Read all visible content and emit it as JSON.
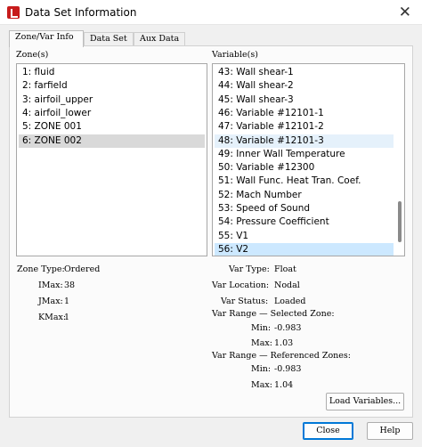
{
  "window": {
    "title": "Data Set Information",
    "close_glyph": "✕"
  },
  "tabs": [
    {
      "label": "Zone/Var Info"
    },
    {
      "label": "Data Set"
    },
    {
      "label": "Aux Data"
    }
  ],
  "zones": {
    "label": "Zone(s)",
    "items": [
      "1: fluid",
      "2: farfield",
      "3: airfoil_upper",
      "4: airfoil_lower",
      "5: ZONE 001",
      "6: ZONE 002"
    ],
    "selected_index": 5
  },
  "variables": {
    "label": "Variable(s)",
    "items": [
      "43: Wall shear-1",
      "44: Wall shear-2",
      "45: Wall shear-3",
      "46: Variable #12101-1",
      "47: Variable #12101-2",
      "48: Variable #12101-3",
      "49: Inner Wall Temperature",
      "50: Variable #12300",
      "51: Wall Func. Heat Tran. Coef.",
      "52: Mach Number",
      "53: Speed of Sound",
      "54: Pressure Coefficient",
      "55: V1",
      "56: V2"
    ],
    "selected_index": 13,
    "hover_index": 5
  },
  "zone_info": {
    "type_label": "Zone Type:",
    "type_value": "Ordered",
    "imax_label": "IMax:",
    "imax_value": "38",
    "jmax_label": "JMax:",
    "jmax_value": "1",
    "kmax_label": "KMax:",
    "kmax_value": "1"
  },
  "var_info": {
    "type_label": "Var Type:",
    "type_value": "Float",
    "location_label": "Var Location:",
    "location_value": "Nodal",
    "status_label": "Var Status:",
    "status_value": "Loaded",
    "selected_range_label": "Var Range — Selected Zone:",
    "sel_min_label": "Min:",
    "sel_min_value": "-0.983",
    "sel_max_label": "Max:",
    "sel_max_value": "1.03",
    "ref_range_label": "Var Range — Referenced Zones:",
    "ref_min_label": "Min:",
    "ref_min_value": "-0.983",
    "ref_max_label": "Max:",
    "ref_max_value": "1.04"
  },
  "buttons": {
    "load_variables": "Load Variables...",
    "close": "Close",
    "help": "Help"
  }
}
